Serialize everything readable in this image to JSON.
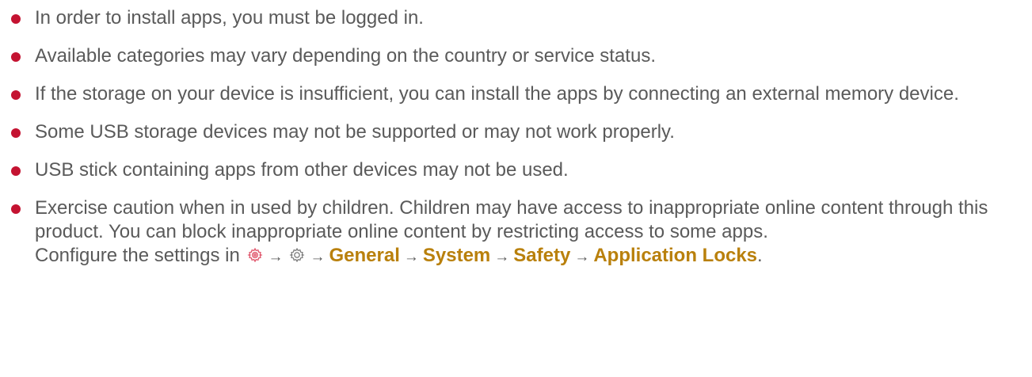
{
  "colors": {
    "bullet": "#c41331",
    "text": "#5a5a5a",
    "menu_path": "#b9800c",
    "settings_icon": "#e0556b",
    "all_settings_icon": "#777777"
  },
  "notes": [
    {
      "text": "In order to install apps, you must be logged in."
    },
    {
      "text": "Available categories may vary depending on the country or service status."
    },
    {
      "text": "If the storage on your device is insufficient, you can install the apps by connecting an external memory device."
    },
    {
      "text": "Some USB storage devices may not be supported or may not work properly."
    },
    {
      "text": "USB stick containing apps from other devices may not be used."
    },
    {
      "text": "Exercise caution when in used by children. Children may have access to inappropriate online content through this product. You can block inappropriate online content by restricting access to some apps."
    }
  ],
  "configure": {
    "prefix": "Configure the settings in",
    "icons": [
      "settings-icon",
      "all-settings-icon"
    ],
    "arrow": "→",
    "path": [
      "General",
      "System",
      "Safety",
      "Application Locks"
    ],
    "suffix": "."
  }
}
